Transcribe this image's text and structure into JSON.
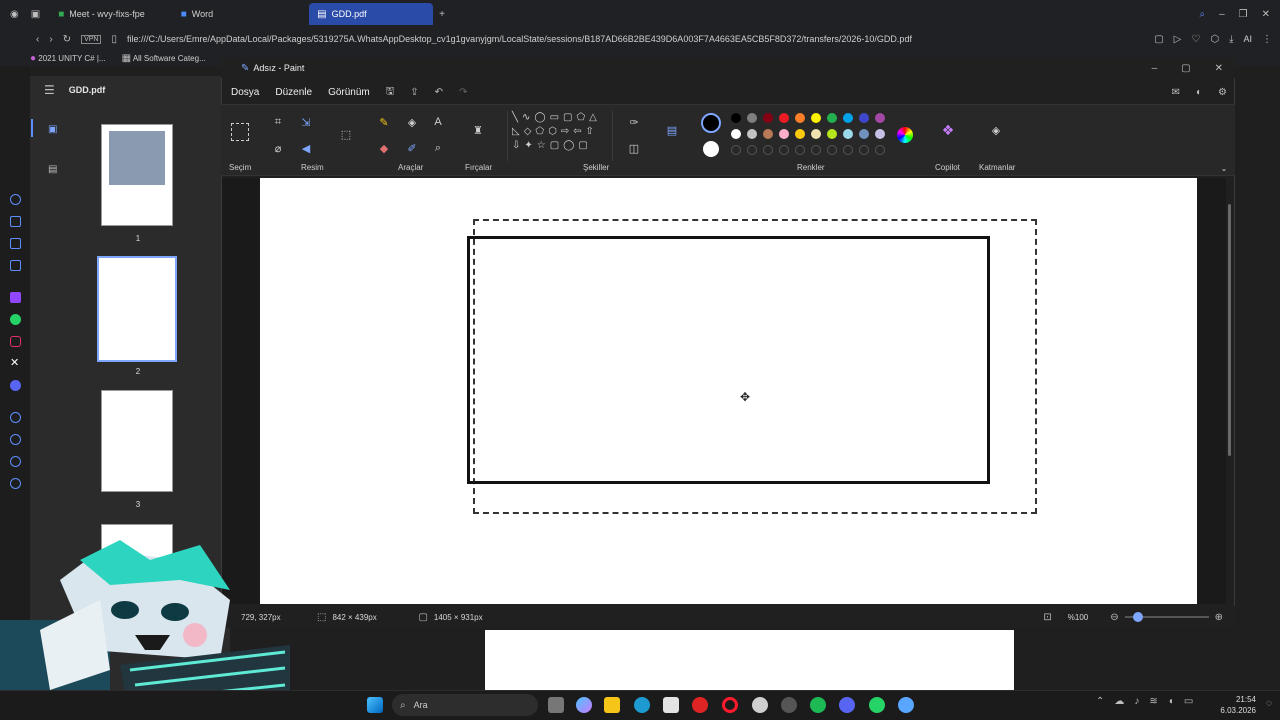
{
  "browser": {
    "tabs": [
      {
        "label": "Meet - wvy-fixs-fpe",
        "active": false
      },
      {
        "label": "Word",
        "active": false
      },
      {
        "label": "GDD.pdf",
        "active": true
      }
    ],
    "url": "file:///C:/Users/Emre/AppData/Local/Packages/5319275A.WhatsAppDesktop_cv1g1gvanyjgm/LocalState/sessions/B187AD66B2BE439D6A003F7A4663EA5CB5F8D372/transfers/2026-10/GDD.pdf",
    "ai_label": "AI",
    "bookmarks": [
      "2021 UNITY C# |...",
      "All Software Categ..."
    ]
  },
  "pdf": {
    "title": "GDD.pdf",
    "pages": [
      "1",
      "2",
      "3"
    ]
  },
  "paint": {
    "window_title": "Adsız - Paint",
    "menu": [
      "Dosya",
      "Düzenle",
      "Görünüm"
    ],
    "groups": {
      "selection": "Seçim",
      "image": "Resim",
      "tools": "Araçlar",
      "brushes": "Fırçalar",
      "shapes": "Şekiller",
      "colors": "Renkler",
      "copilot": "Copilot",
      "layers": "Katmanlar"
    },
    "status": {
      "cursor": "729, 327px",
      "selection_size": "842 × 439px",
      "canvas_size": "1405 × 931px",
      "zoom": "%100"
    },
    "colors": {
      "row1": [
        "#000000",
        "#7f7f7f",
        "#880015",
        "#ed1c24",
        "#ff7f27",
        "#fff200",
        "#22b14c",
        "#00a2e8",
        "#3f48cc",
        "#a349a4"
      ],
      "row2": [
        "#ffffff",
        "#c3c3c3",
        "#b97a57",
        "#ffaec9",
        "#ffc90e",
        "#efe4b0",
        "#b5e61d",
        "#99d9ea",
        "#7092be",
        "#c8bfe7"
      ]
    }
  },
  "taskbar": {
    "search_label": "Ara",
    "time": "21:54",
    "date": "6.03.2026"
  }
}
